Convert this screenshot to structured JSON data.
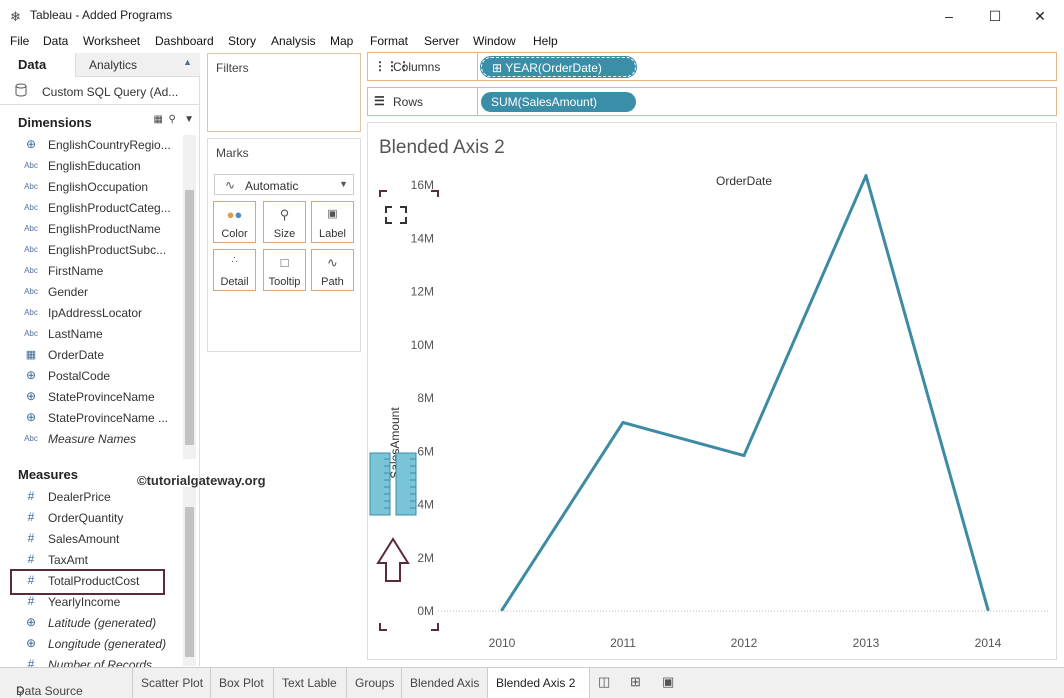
{
  "window": {
    "title": "Tableau - Added Programs"
  },
  "menu": [
    "File",
    "Data",
    "Worksheet",
    "Dashboard",
    "Story",
    "Analysis",
    "Map",
    "Format",
    "Server",
    "Window",
    "Help"
  ],
  "left_panel": {
    "tab_data": "Data",
    "tab_analytics": "Analytics",
    "datasource": "Custom SQL Query (Ad...",
    "dimensions_title": "Dimensions",
    "dimensions": [
      {
        "icon": "globe",
        "label": "EnglishCountryRegio..."
      },
      {
        "icon": "Abc",
        "label": "EnglishEducation"
      },
      {
        "icon": "Abc",
        "label": "EnglishOccupation"
      },
      {
        "icon": "Abc",
        "label": "EnglishProductCateg..."
      },
      {
        "icon": "Abc",
        "label": "EnglishProductName"
      },
      {
        "icon": "Abc",
        "label": "EnglishProductSubc..."
      },
      {
        "icon": "Abc",
        "label": "FirstName"
      },
      {
        "icon": "Abc",
        "label": "Gender"
      },
      {
        "icon": "Abc",
        "label": "IpAddressLocator"
      },
      {
        "icon": "Abc",
        "label": "LastName"
      },
      {
        "icon": "calendar",
        "label": "OrderDate"
      },
      {
        "icon": "globe",
        "label": "PostalCode"
      },
      {
        "icon": "globe",
        "label": "StateProvinceName"
      },
      {
        "icon": "globe",
        "label": "StateProvinceName ..."
      },
      {
        "icon": "Abc",
        "label": "Measure Names",
        "italic": true
      }
    ],
    "measures_title": "Measures",
    "measures": [
      {
        "icon": "#",
        "label": "DealerPrice"
      },
      {
        "icon": "#",
        "label": "OrderQuantity"
      },
      {
        "icon": "#",
        "label": "SalesAmount"
      },
      {
        "icon": "#",
        "label": "TaxAmt"
      },
      {
        "icon": "#",
        "label": "TotalProductCost"
      },
      {
        "icon": "#",
        "label": "YearlyIncome"
      },
      {
        "icon": "globe",
        "label": "Latitude (generated)",
        "italic": true
      },
      {
        "icon": "globe",
        "label": "Longitude (generated)",
        "italic": true
      },
      {
        "icon": "#",
        "label": "Number of Records",
        "italic": true
      }
    ]
  },
  "filters": {
    "title": "Filters"
  },
  "marks": {
    "title": "Marks",
    "type": "Automatic",
    "cards": [
      "Color",
      "Size",
      "Label",
      "Detail",
      "Tooltip",
      "Path"
    ]
  },
  "shelves": {
    "columns_label": "Columns",
    "columns_pill": "YEAR(OrderDate)",
    "rows_label": "Rows",
    "rows_pill": "SUM(SalesAmount)"
  },
  "view": {
    "title": "Blended Axis 2",
    "watermark": "©tutorialgateway.org"
  },
  "chart_data": {
    "type": "line",
    "title": "",
    "xlabel": "OrderDate",
    "ylabel": "SalesAmount",
    "x": [
      "2010",
      "2011",
      "2012",
      "2013",
      "2014"
    ],
    "values": [
      0.04,
      7.08,
      5.84,
      16.35,
      0.05
    ],
    "unit": "M",
    "y_ticks": [
      "0M",
      "2M",
      "4M",
      "6M",
      "8M",
      "10M",
      "12M",
      "14M",
      "16M"
    ],
    "ylim": [
      0,
      16
    ],
    "color": "#3d8aa3",
    "grid": false
  },
  "sheet_tabs": [
    "Data Source",
    "Scatter Plot",
    "Box Plot",
    "Text Lable",
    "Groups",
    "Blended Axis",
    "Blended Axis 2"
  ],
  "active_tab": "Blended Axis 2"
}
